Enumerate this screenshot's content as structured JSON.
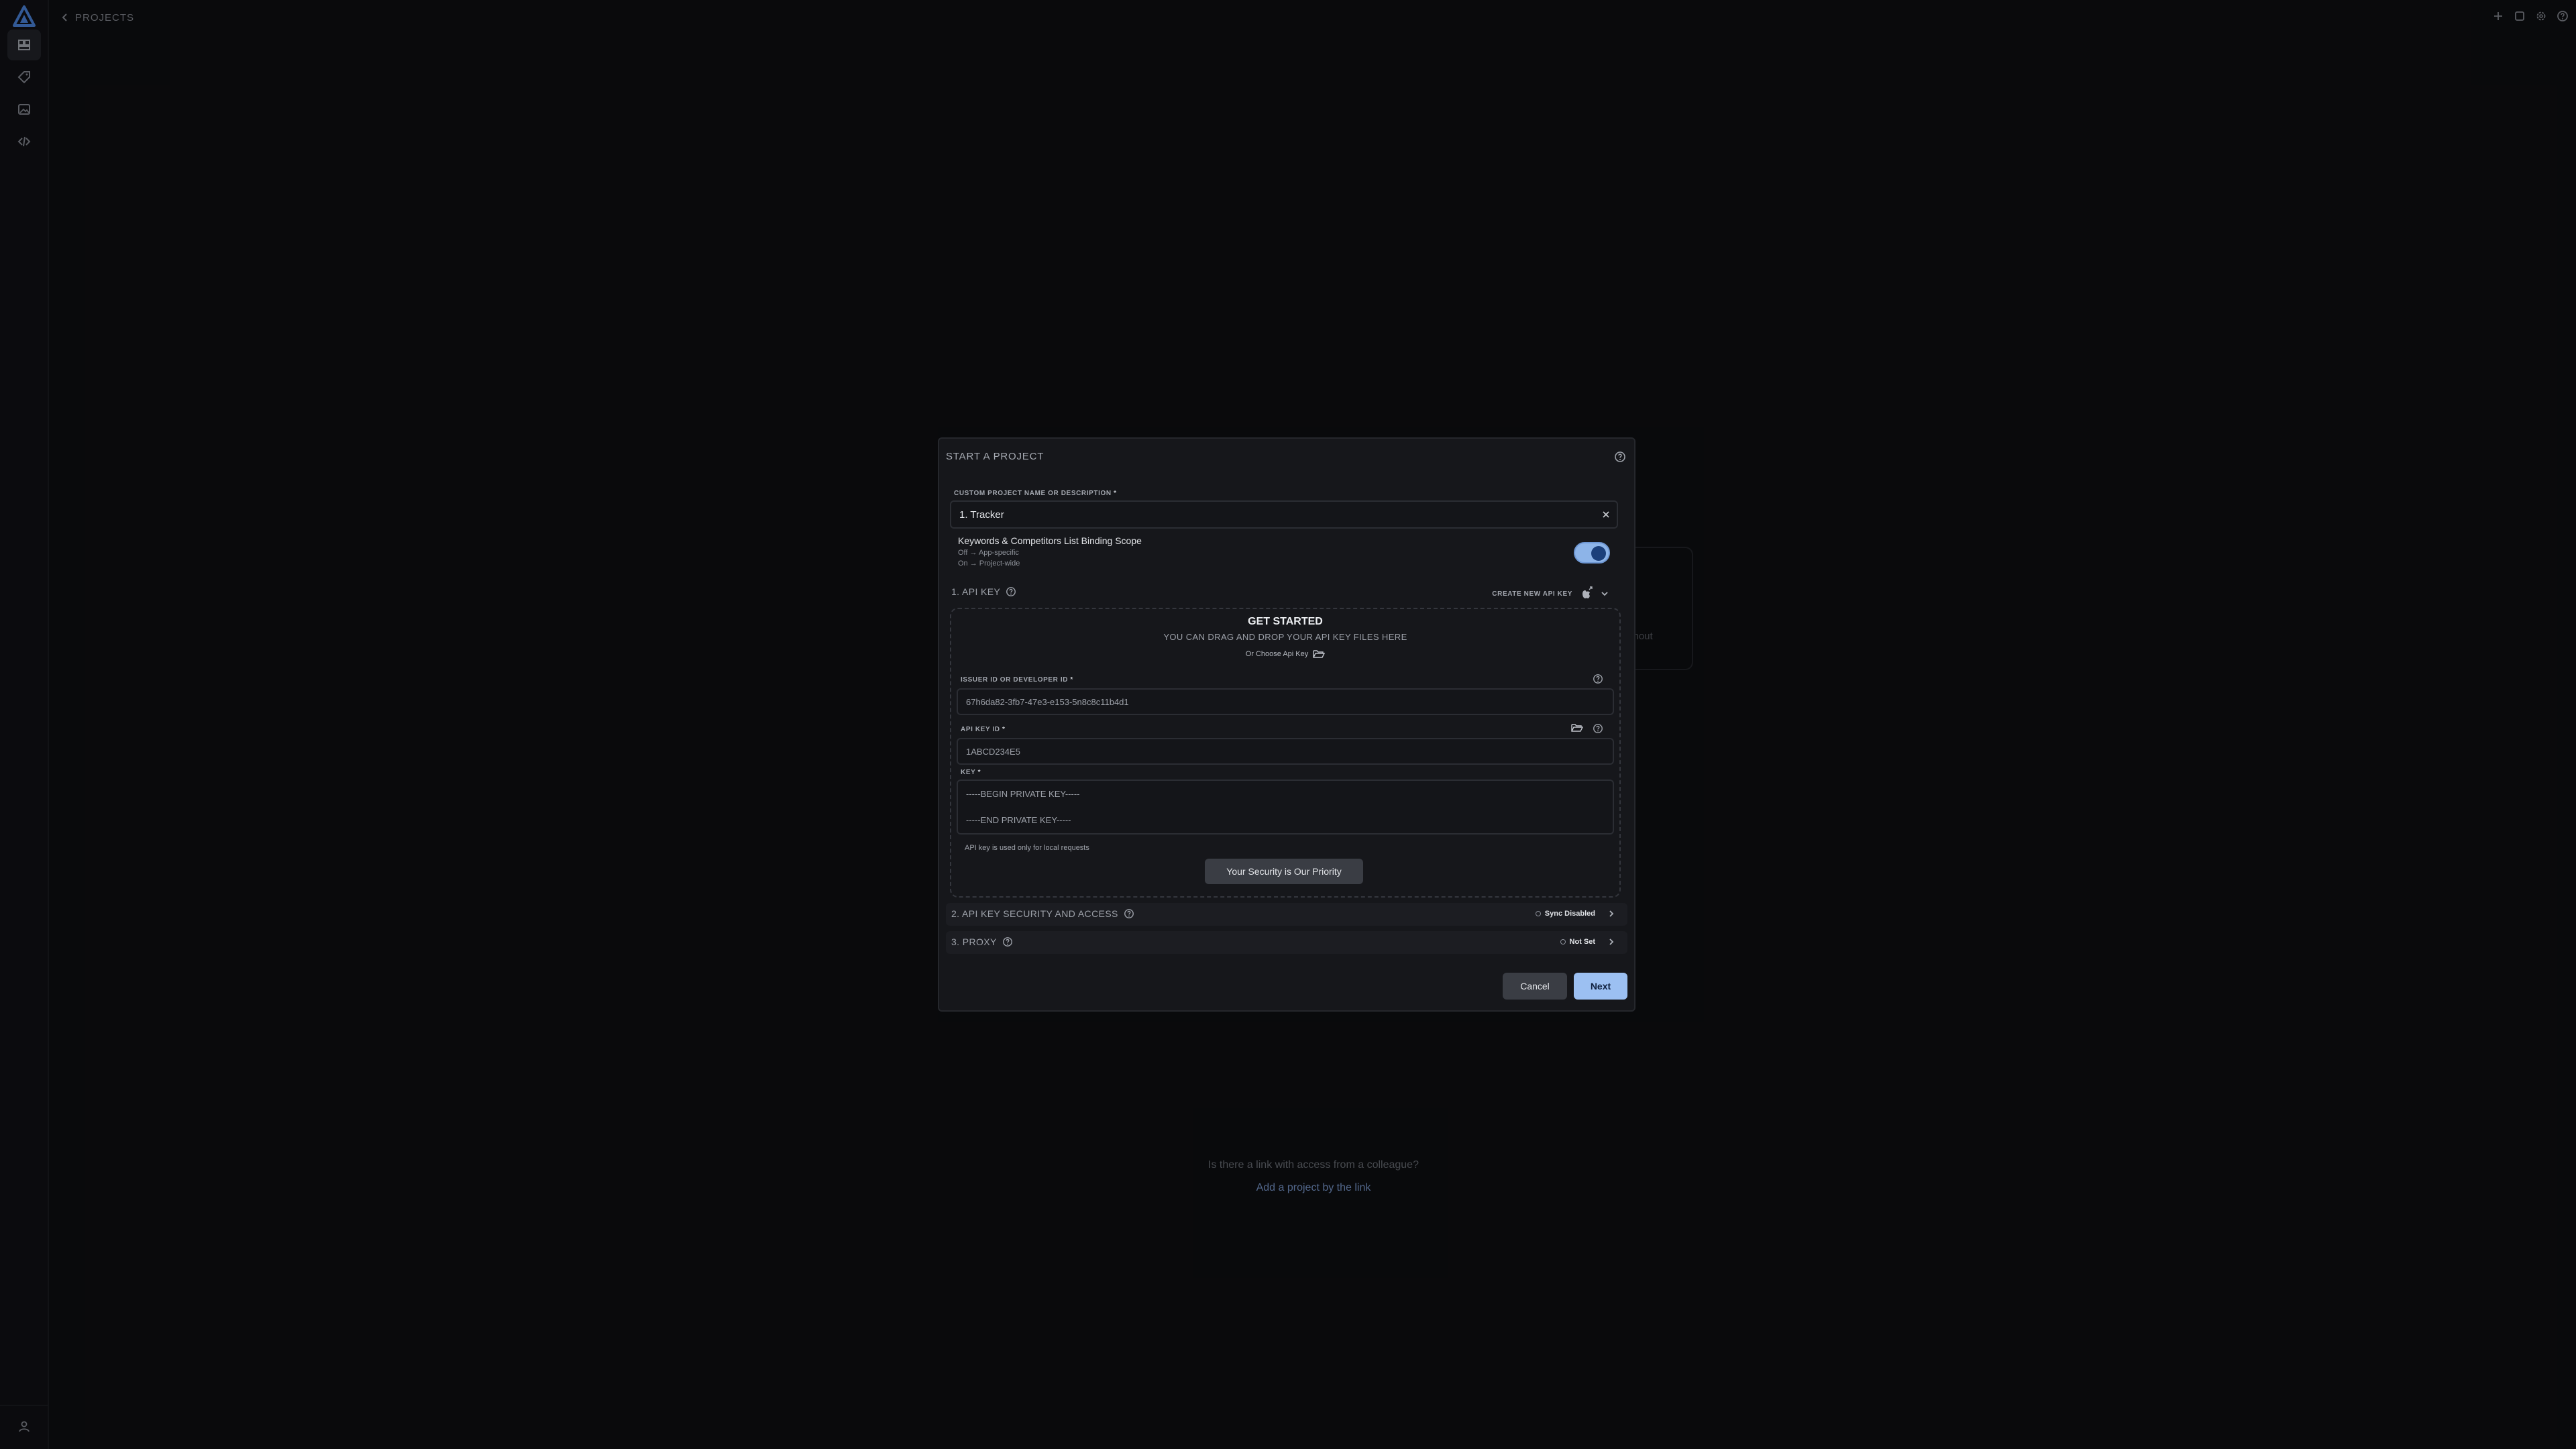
{
  "breadcrumb": {
    "back_label": "PROJECTS"
  },
  "background": {
    "card_text": "ithout",
    "colleague_question": "Is there a link with access from a colleague?",
    "colleague_link": "Add a project by the link"
  },
  "modal": {
    "title": "START A PROJECT",
    "project_name": {
      "label": "CUSTOM PROJECT NAME OR DESCRIPTION",
      "required": "*",
      "value": "1. Tracker"
    },
    "binding_scope": {
      "title": "Keywords & Competitors List Binding Scope",
      "off_line": "Off → App-specific",
      "on_line": "On → Project-wide",
      "enabled": true
    },
    "api_key_section": {
      "title": "1. API KEY",
      "create_new_label": "CREATE NEW API KEY",
      "dropzone": {
        "title": "GET STARTED",
        "subtitle": "YOU CAN DRAG AND DROP YOUR API KEY FILES HERE",
        "choose_label": "Or Choose Api Key"
      },
      "issuer_id": {
        "label": "ISSUER ID OR DEVELOPER ID",
        "required": "*",
        "value": "67h6da82-3fb7-47e3-e153-5n8c8c11b4d1"
      },
      "api_key_id": {
        "label": "API KEY ID",
        "required": "*",
        "value": "1ABCD234E5"
      },
      "key": {
        "label": "KEY",
        "required": "*",
        "line1": "-----BEGIN PRIVATE KEY-----",
        "line2": "-----END PRIVATE KEY-----"
      },
      "hint": "API key is used only for local requests",
      "security_button": "Your Security is Our Priority"
    },
    "security_section": {
      "title": "2. API KEY SECURITY AND ACCESS",
      "status": "Sync Disabled"
    },
    "proxy_section": {
      "title": "3. PROXY",
      "status": "Not Set"
    },
    "cancel_label": "Cancel",
    "next_label": "Next"
  },
  "colors": {
    "accent": "#9cc0f2",
    "background": "#0f1013",
    "modal": "#16171b"
  },
  "icons": {
    "sidebar": [
      "projects-icon",
      "tag-icon",
      "image-icon",
      "code-icon"
    ],
    "top": [
      "plus-icon",
      "window-icon",
      "gear-icon",
      "help-icon"
    ]
  }
}
